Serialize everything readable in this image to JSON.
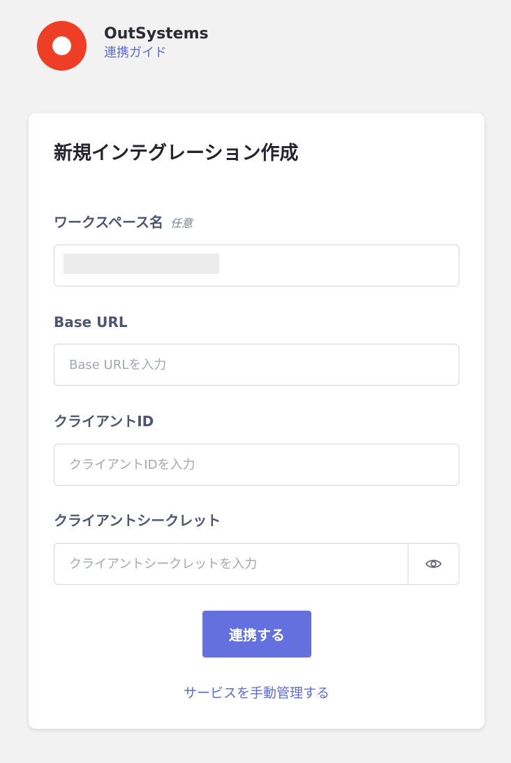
{
  "header": {
    "app_name": "OutSystems",
    "guide_link": "連携ガイド",
    "logo_color": "#ee3e26"
  },
  "form": {
    "title": "新規インテグレーション作成",
    "workspace": {
      "label": "ワークスペース名",
      "optional": "任意"
    },
    "base_url": {
      "label": "Base URL",
      "placeholder": "Base URLを入力"
    },
    "client_id": {
      "label": "クライアントID",
      "placeholder": "クライアントIDを入力"
    },
    "client_secret": {
      "label": "クライアントシークレット",
      "placeholder": "クライアントシークレットを入力",
      "toggle_icon": "eye-icon"
    },
    "submit_label": "連携する",
    "manual_link": "サービスを手動管理する"
  },
  "colors": {
    "accent": "#6370dd",
    "link": "#5b6dd6",
    "background": "#f2f2f2"
  }
}
